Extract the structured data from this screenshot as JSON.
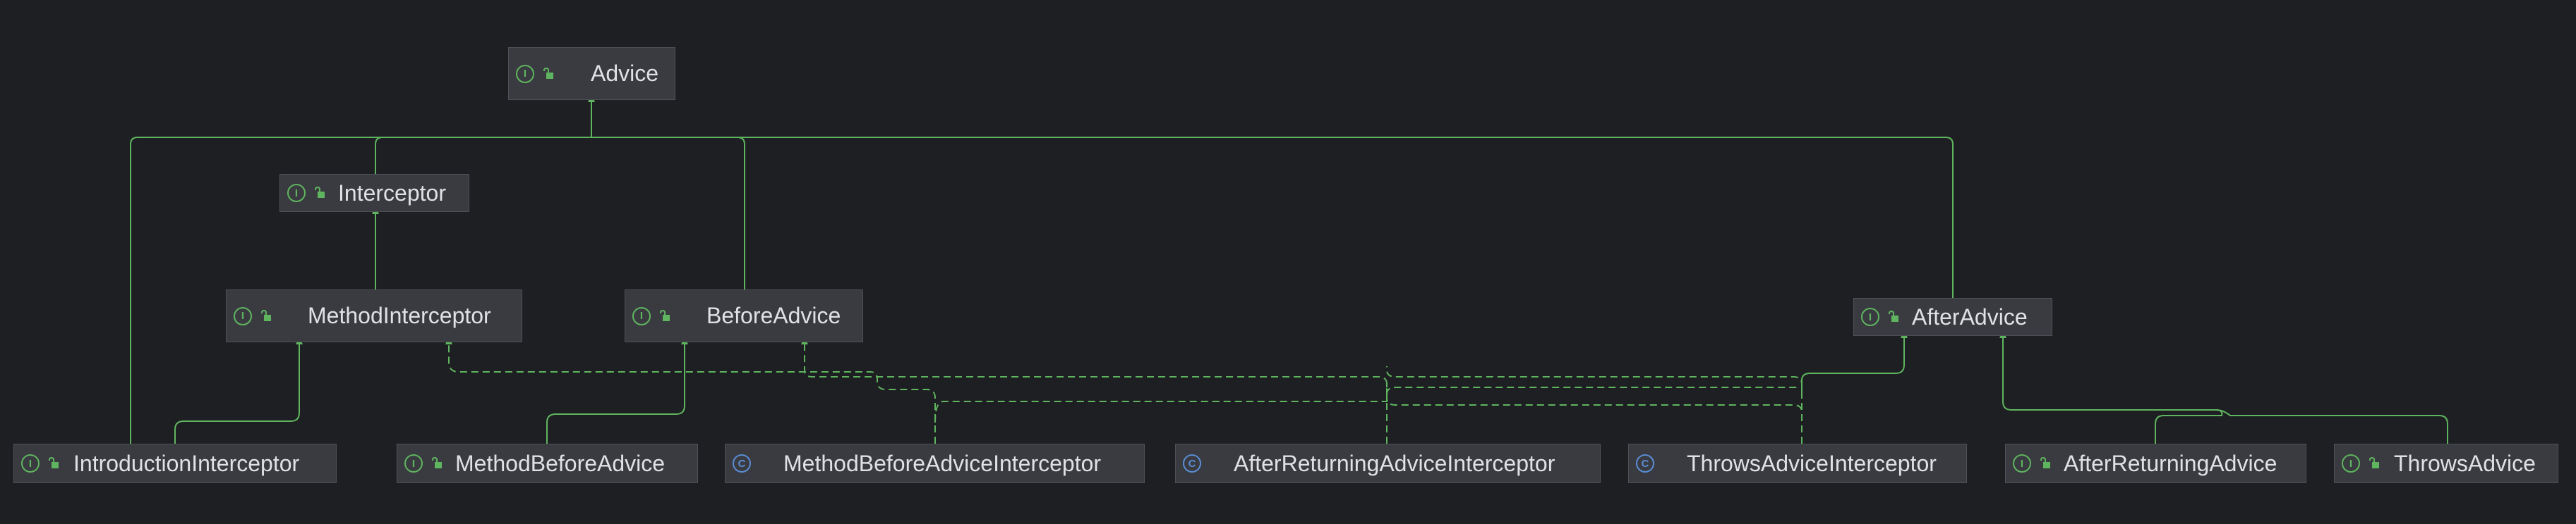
{
  "diagram": {
    "colors": {
      "background": "#1e1f22",
      "node_fill": "#393b40",
      "node_border": "#4e5157",
      "node_text": "#dfe1e5",
      "edge": "#5fb55f",
      "interface_icon": "#5fb55f",
      "class_icon": "#5b8dd6"
    },
    "nodes": [
      {
        "id": "advice",
        "label": "Advice",
        "kind": "interface",
        "kind_glyph": "I",
        "icon": "interface-icon"
      },
      {
        "id": "interceptor",
        "label": "Interceptor",
        "kind": "interface",
        "kind_glyph": "I",
        "icon": "interface-icon"
      },
      {
        "id": "method-interceptor",
        "label": "MethodInterceptor",
        "kind": "interface",
        "kind_glyph": "I",
        "icon": "interface-icon"
      },
      {
        "id": "before-advice",
        "label": "BeforeAdvice",
        "kind": "interface",
        "kind_glyph": "I",
        "icon": "interface-icon"
      },
      {
        "id": "after-advice",
        "label": "AfterAdvice",
        "kind": "interface",
        "kind_glyph": "I",
        "icon": "interface-icon"
      },
      {
        "id": "introduction-interceptor",
        "label": "IntroductionInterceptor",
        "kind": "interface",
        "kind_glyph": "I",
        "icon": "interface-icon"
      },
      {
        "id": "method-before-advice",
        "label": "MethodBeforeAdvice",
        "kind": "interface",
        "kind_glyph": "I",
        "icon": "interface-icon"
      },
      {
        "id": "method-before-advice-interceptor",
        "label": "MethodBeforeAdviceInterceptor",
        "kind": "class",
        "kind_glyph": "C",
        "icon": "class-icon"
      },
      {
        "id": "after-returning-advice-interceptor",
        "label": "AfterReturningAdviceInterceptor",
        "kind": "class",
        "kind_glyph": "C",
        "icon": "class-icon"
      },
      {
        "id": "throws-advice-interceptor",
        "label": "ThrowsAdviceInterceptor",
        "kind": "class",
        "kind_glyph": "C",
        "icon": "class-icon"
      },
      {
        "id": "after-returning-advice",
        "label": "AfterReturningAdvice",
        "kind": "interface",
        "kind_glyph": "I",
        "icon": "interface-icon"
      },
      {
        "id": "throws-advice",
        "label": "ThrowsAdvice",
        "kind": "interface",
        "kind_glyph": "I",
        "icon": "interface-icon"
      }
    ],
    "edges": [
      {
        "from": "interceptor",
        "to": "advice",
        "relation": "extends"
      },
      {
        "from": "before-advice",
        "to": "advice",
        "relation": "extends"
      },
      {
        "from": "after-advice",
        "to": "advice",
        "relation": "extends"
      },
      {
        "from": "introduction-interceptor",
        "to": "advice",
        "relation": "extends"
      },
      {
        "from": "method-interceptor",
        "to": "interceptor",
        "relation": "extends"
      },
      {
        "from": "introduction-interceptor",
        "to": "method-interceptor",
        "relation": "extends"
      },
      {
        "from": "method-before-advice",
        "to": "before-advice",
        "relation": "extends"
      },
      {
        "from": "after-returning-advice",
        "to": "after-advice",
        "relation": "extends"
      },
      {
        "from": "throws-advice",
        "to": "after-advice",
        "relation": "extends"
      },
      {
        "from": "method-before-advice-interceptor",
        "to": "method-interceptor",
        "relation": "implements"
      },
      {
        "from": "method-before-advice-interceptor",
        "to": "before-advice",
        "relation": "implements"
      },
      {
        "from": "after-returning-advice-interceptor",
        "to": "method-interceptor",
        "relation": "implements"
      },
      {
        "from": "after-returning-advice-interceptor",
        "to": "after-advice",
        "relation": "implements"
      },
      {
        "from": "throws-advice-interceptor",
        "to": "method-interceptor",
        "relation": "implements"
      },
      {
        "from": "throws-advice-interceptor",
        "to": "after-advice",
        "relation": "implements"
      }
    ]
  }
}
